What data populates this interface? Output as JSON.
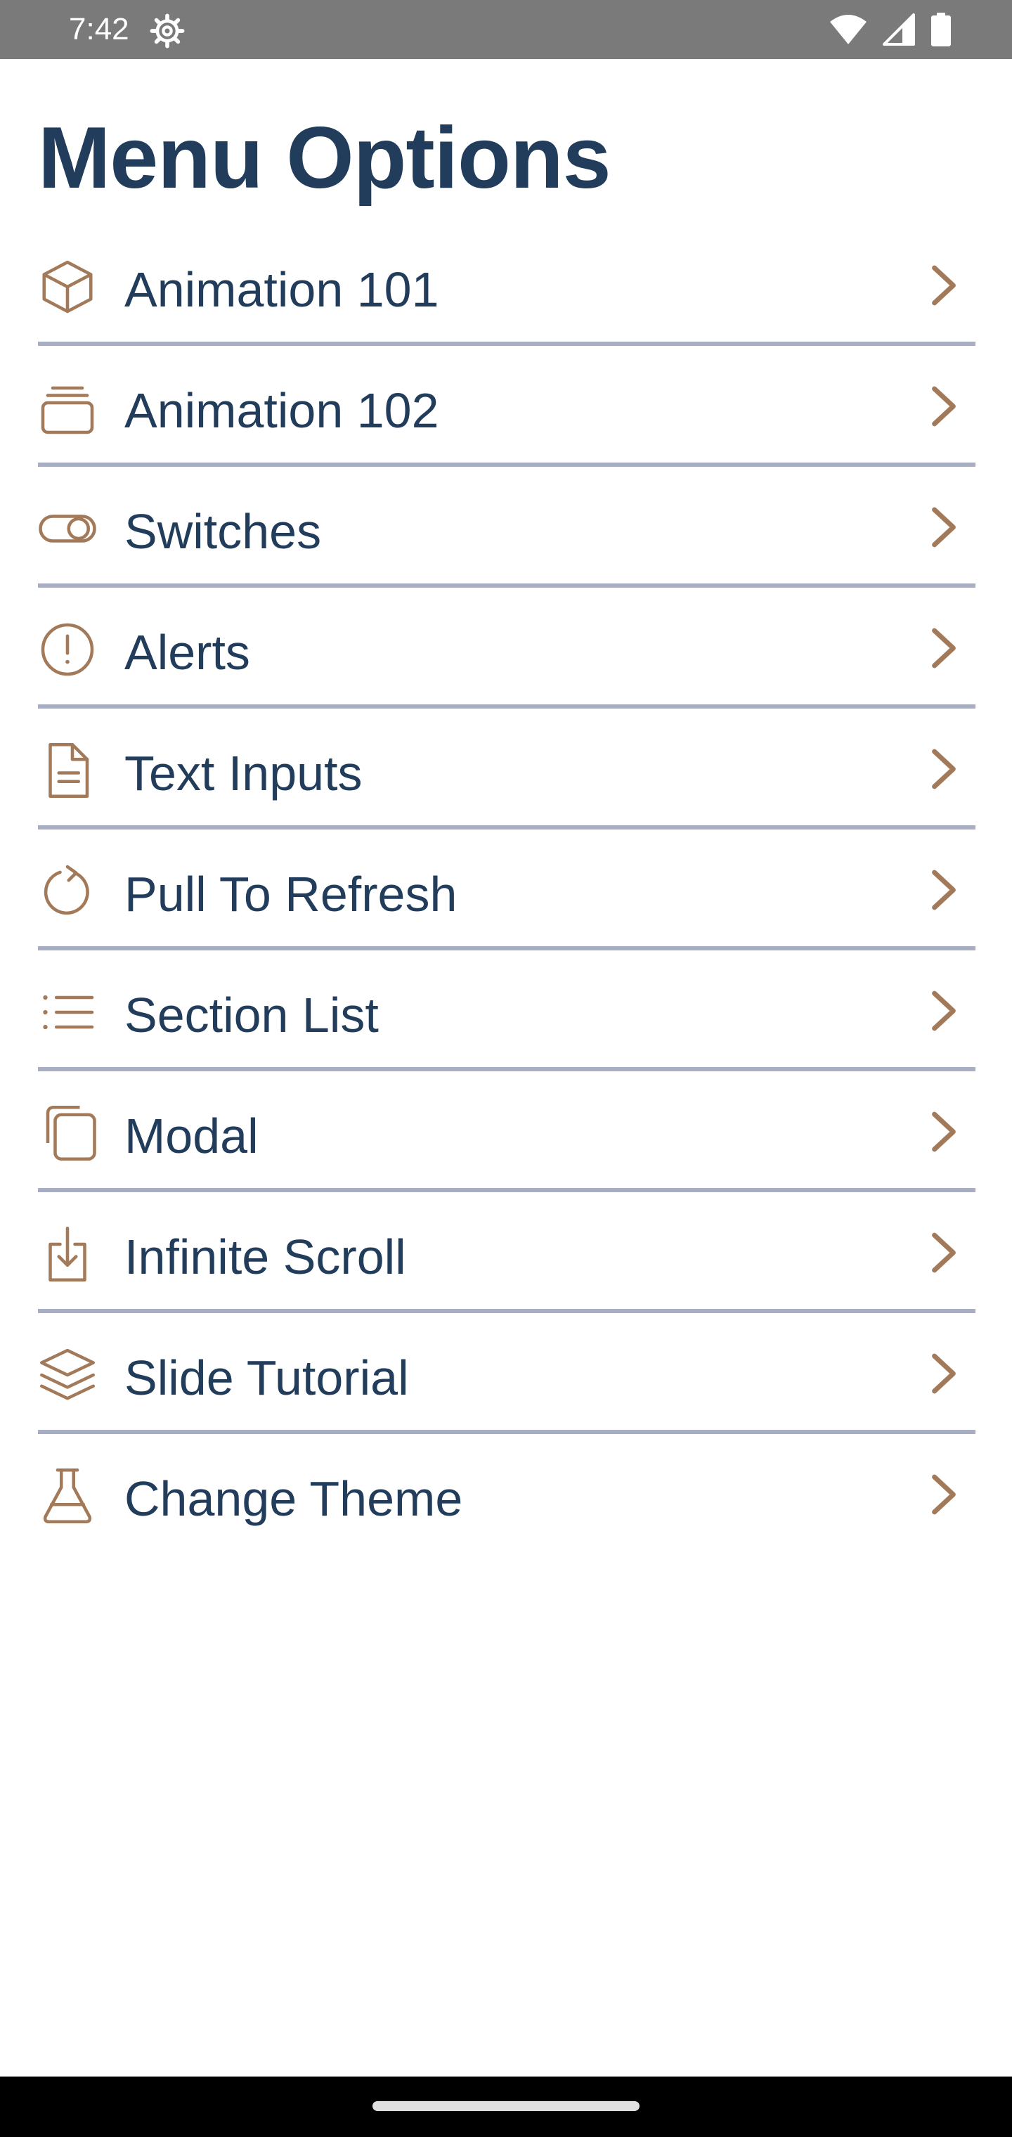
{
  "status_bar": {
    "time": "7:42",
    "icons": [
      "gear-icon",
      "wifi-icon",
      "signal-icon",
      "battery-icon"
    ]
  },
  "title": "Menu Options",
  "colors": {
    "title": "#213d5b",
    "label": "#213d5b",
    "icon_accent": "#a27a5a",
    "divider": "#a7adc2",
    "status_bar": "#7a7a7a",
    "nav_bar": "#000000"
  },
  "menu": {
    "items": [
      {
        "label": "Animation 101",
        "icon": "cube-icon"
      },
      {
        "label": "Animation 102",
        "icon": "stack-icon"
      },
      {
        "label": "Switches",
        "icon": "toggle-icon"
      },
      {
        "label": "Alerts",
        "icon": "alert-circle-icon"
      },
      {
        "label": "Text Inputs",
        "icon": "document-icon"
      },
      {
        "label": "Pull To Refresh",
        "icon": "refresh-icon"
      },
      {
        "label": "Section List",
        "icon": "list-icon"
      },
      {
        "label": "Modal",
        "icon": "copy-icon"
      },
      {
        "label": "Infinite Scroll",
        "icon": "download-icon"
      },
      {
        "label": "Slide Tutorial",
        "icon": "layers-icon"
      },
      {
        "label": "Change Theme",
        "icon": "flask-icon"
      }
    ]
  }
}
